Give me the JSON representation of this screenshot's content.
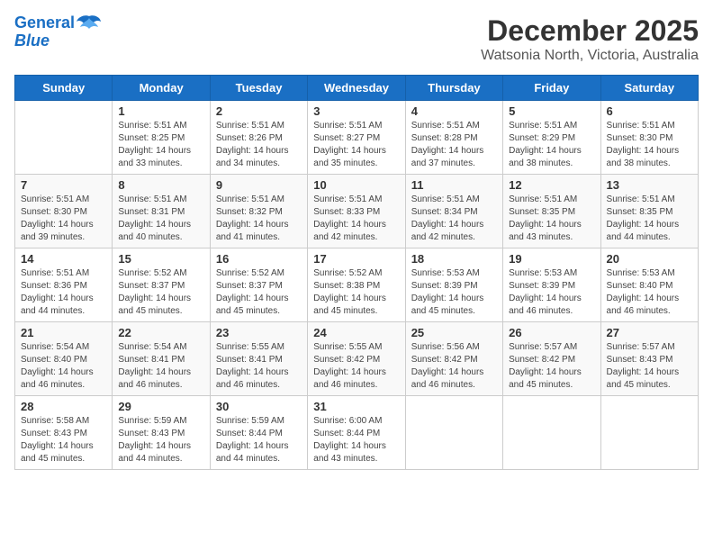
{
  "header": {
    "logo_line1": "General",
    "logo_line2": "Blue",
    "month_title": "December 2025",
    "location": "Watsonia North, Victoria, Australia"
  },
  "days_of_week": [
    "Sunday",
    "Monday",
    "Tuesday",
    "Wednesday",
    "Thursday",
    "Friday",
    "Saturday"
  ],
  "weeks": [
    [
      {
        "day": "",
        "info": ""
      },
      {
        "day": "1",
        "info": "Sunrise: 5:51 AM\nSunset: 8:25 PM\nDaylight: 14 hours\nand 33 minutes."
      },
      {
        "day": "2",
        "info": "Sunrise: 5:51 AM\nSunset: 8:26 PM\nDaylight: 14 hours\nand 34 minutes."
      },
      {
        "day": "3",
        "info": "Sunrise: 5:51 AM\nSunset: 8:27 PM\nDaylight: 14 hours\nand 35 minutes."
      },
      {
        "day": "4",
        "info": "Sunrise: 5:51 AM\nSunset: 8:28 PM\nDaylight: 14 hours\nand 37 minutes."
      },
      {
        "day": "5",
        "info": "Sunrise: 5:51 AM\nSunset: 8:29 PM\nDaylight: 14 hours\nand 38 minutes."
      },
      {
        "day": "6",
        "info": "Sunrise: 5:51 AM\nSunset: 8:30 PM\nDaylight: 14 hours\nand 38 minutes."
      }
    ],
    [
      {
        "day": "7",
        "info": "Sunrise: 5:51 AM\nSunset: 8:30 PM\nDaylight: 14 hours\nand 39 minutes."
      },
      {
        "day": "8",
        "info": "Sunrise: 5:51 AM\nSunset: 8:31 PM\nDaylight: 14 hours\nand 40 minutes."
      },
      {
        "day": "9",
        "info": "Sunrise: 5:51 AM\nSunset: 8:32 PM\nDaylight: 14 hours\nand 41 minutes."
      },
      {
        "day": "10",
        "info": "Sunrise: 5:51 AM\nSunset: 8:33 PM\nDaylight: 14 hours\nand 42 minutes."
      },
      {
        "day": "11",
        "info": "Sunrise: 5:51 AM\nSunset: 8:34 PM\nDaylight: 14 hours\nand 42 minutes."
      },
      {
        "day": "12",
        "info": "Sunrise: 5:51 AM\nSunset: 8:35 PM\nDaylight: 14 hours\nand 43 minutes."
      },
      {
        "day": "13",
        "info": "Sunrise: 5:51 AM\nSunset: 8:35 PM\nDaylight: 14 hours\nand 44 minutes."
      }
    ],
    [
      {
        "day": "14",
        "info": "Sunrise: 5:51 AM\nSunset: 8:36 PM\nDaylight: 14 hours\nand 44 minutes."
      },
      {
        "day": "15",
        "info": "Sunrise: 5:52 AM\nSunset: 8:37 PM\nDaylight: 14 hours\nand 45 minutes."
      },
      {
        "day": "16",
        "info": "Sunrise: 5:52 AM\nSunset: 8:37 PM\nDaylight: 14 hours\nand 45 minutes."
      },
      {
        "day": "17",
        "info": "Sunrise: 5:52 AM\nSunset: 8:38 PM\nDaylight: 14 hours\nand 45 minutes."
      },
      {
        "day": "18",
        "info": "Sunrise: 5:53 AM\nSunset: 8:39 PM\nDaylight: 14 hours\nand 45 minutes."
      },
      {
        "day": "19",
        "info": "Sunrise: 5:53 AM\nSunset: 8:39 PM\nDaylight: 14 hours\nand 46 minutes."
      },
      {
        "day": "20",
        "info": "Sunrise: 5:53 AM\nSunset: 8:40 PM\nDaylight: 14 hours\nand 46 minutes."
      }
    ],
    [
      {
        "day": "21",
        "info": "Sunrise: 5:54 AM\nSunset: 8:40 PM\nDaylight: 14 hours\nand 46 minutes."
      },
      {
        "day": "22",
        "info": "Sunrise: 5:54 AM\nSunset: 8:41 PM\nDaylight: 14 hours\nand 46 minutes."
      },
      {
        "day": "23",
        "info": "Sunrise: 5:55 AM\nSunset: 8:41 PM\nDaylight: 14 hours\nand 46 minutes."
      },
      {
        "day": "24",
        "info": "Sunrise: 5:55 AM\nSunset: 8:42 PM\nDaylight: 14 hours\nand 46 minutes."
      },
      {
        "day": "25",
        "info": "Sunrise: 5:56 AM\nSunset: 8:42 PM\nDaylight: 14 hours\nand 46 minutes."
      },
      {
        "day": "26",
        "info": "Sunrise: 5:57 AM\nSunset: 8:42 PM\nDaylight: 14 hours\nand 45 minutes."
      },
      {
        "day": "27",
        "info": "Sunrise: 5:57 AM\nSunset: 8:43 PM\nDaylight: 14 hours\nand 45 minutes."
      }
    ],
    [
      {
        "day": "28",
        "info": "Sunrise: 5:58 AM\nSunset: 8:43 PM\nDaylight: 14 hours\nand 45 minutes."
      },
      {
        "day": "29",
        "info": "Sunrise: 5:59 AM\nSunset: 8:43 PM\nDaylight: 14 hours\nand 44 minutes."
      },
      {
        "day": "30",
        "info": "Sunrise: 5:59 AM\nSunset: 8:44 PM\nDaylight: 14 hours\nand 44 minutes."
      },
      {
        "day": "31",
        "info": "Sunrise: 6:00 AM\nSunset: 8:44 PM\nDaylight: 14 hours\nand 43 minutes."
      },
      {
        "day": "",
        "info": ""
      },
      {
        "day": "",
        "info": ""
      },
      {
        "day": "",
        "info": ""
      }
    ]
  ]
}
